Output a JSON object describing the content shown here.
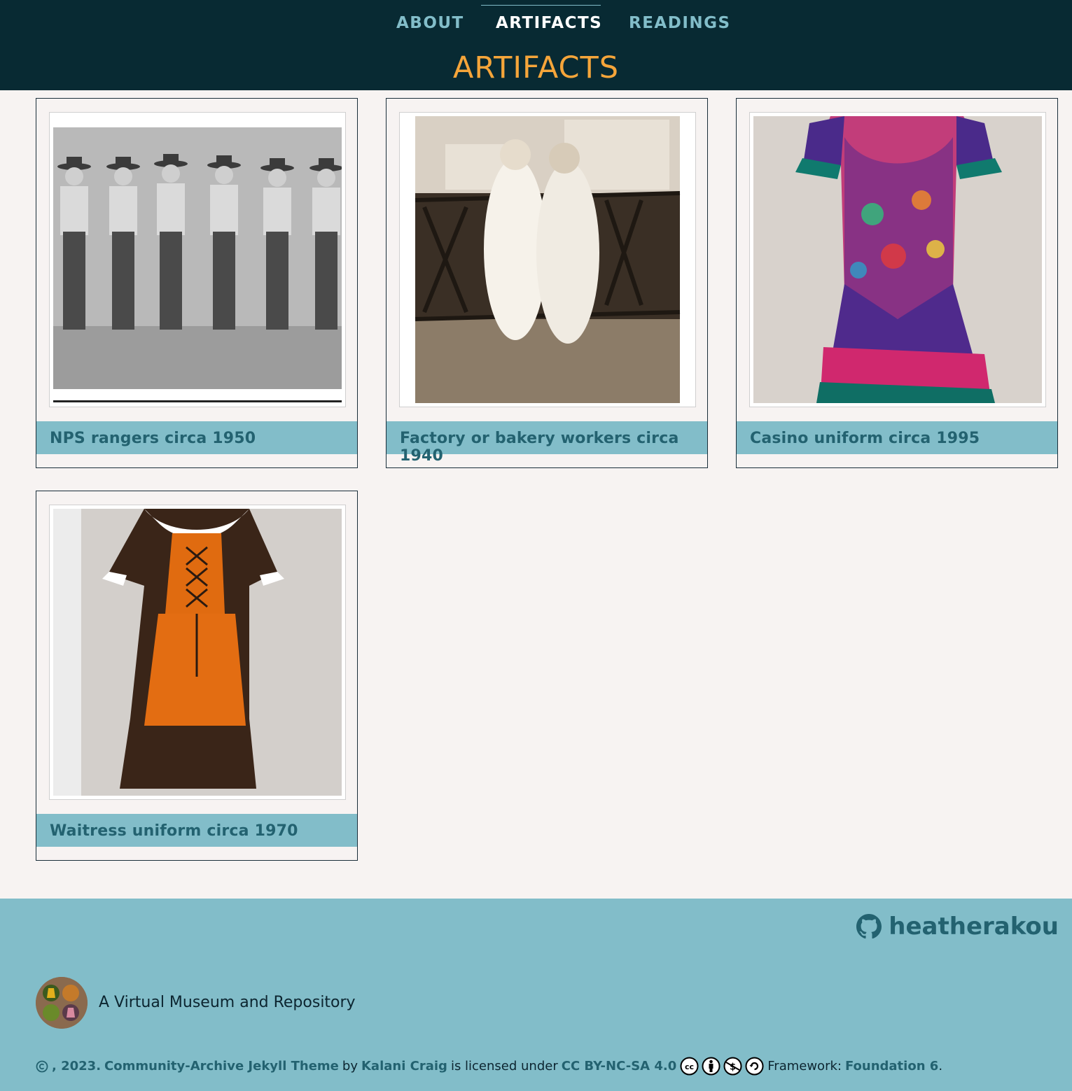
{
  "nav": {
    "items": [
      {
        "label": "ABOUT",
        "active": false
      },
      {
        "label": "ARTIFACTS",
        "active": true
      },
      {
        "label": "READINGS",
        "active": false
      }
    ]
  },
  "page_title": "ARTIFACTS",
  "artifacts": [
    {
      "caption": "NPS rangers circa 1950"
    },
    {
      "caption": "Factory or bakery workers circa 1940"
    },
    {
      "caption": "Casino uniform circa 1995"
    },
    {
      "caption": "Waitress uniform circa 1970"
    }
  ],
  "footer": {
    "github_user": "heatherakou",
    "tagline": "A Virtual Museum and Repository",
    "copyright_prefix": ", 2023.",
    "theme_link": "Community-Archive Jekyll Theme",
    "by": "by",
    "author_link": "Kalani Craig",
    "licensed_under": "is licensed under",
    "license_link": "CC BY-NC-SA 4.0",
    "framework_label": "Framework:",
    "framework_link": "Foundation 6",
    "period": "."
  },
  "colors": {
    "header_bg": "#082a33",
    "accent_orange": "#f5a53a",
    "teal": "#82bdc9",
    "dark_teal": "#236270",
    "page_bg": "#f7f3f2"
  }
}
